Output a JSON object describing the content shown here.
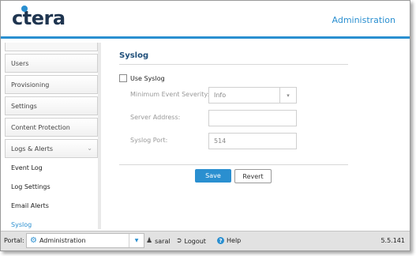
{
  "header": {
    "logo_text": "ctera",
    "title": "Administration"
  },
  "sidebar": {
    "sections": [
      {
        "label": "Users"
      },
      {
        "label": "Provisioning"
      },
      {
        "label": "Settings"
      },
      {
        "label": "Content Protection"
      },
      {
        "label": "Logs & Alerts"
      }
    ],
    "subitems": [
      {
        "label": "Event Log"
      },
      {
        "label": "Log Settings"
      },
      {
        "label": "Email Alerts"
      },
      {
        "label": "Syslog"
      }
    ]
  },
  "main": {
    "title": "Syslog",
    "use_syslog_label": "Use Syslog",
    "use_syslog_checked": false,
    "min_severity_label": "Minimum Event Severity:",
    "min_severity_value": "Info",
    "server_address_label": "Server Address:",
    "server_address_value": "",
    "port_label": "Syslog Port:",
    "port_placeholder": "514",
    "save_label": "Save",
    "revert_label": "Revert"
  },
  "status": {
    "portal_label": "Portal:",
    "portal_value": "Administration",
    "user": "saral",
    "logout": "Logout",
    "help": "Help",
    "version": "5.5.141"
  },
  "colors": {
    "accent": "#2a8fd0",
    "logo": "#1f3550"
  }
}
